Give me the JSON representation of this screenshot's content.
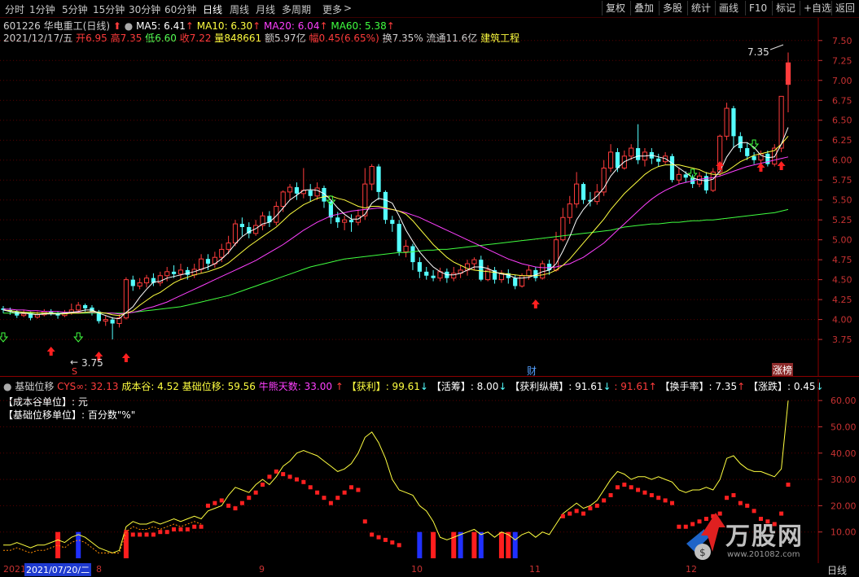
{
  "toolbar": {
    "tabs": [
      "分时",
      "1分钟",
      "5分钟",
      "15分钟",
      "30分钟",
      "60分钟",
      "日线",
      "周线",
      "月线",
      "多周期",
      "更多"
    ],
    "more_arrow": ">",
    "right_buttons": [
      "复权",
      "叠加",
      "多股",
      "统计",
      "画线",
      "F10",
      "标记",
      "+自选",
      "返回"
    ]
  },
  "header": {
    "code": "601226",
    "name": "华电重工",
    "period": "(日线)",
    "ma5": "MA5: 6.41",
    "ma10": "MA10: 6.30",
    "ma20": "MA20: 6.04",
    "ma60": "MA60: 5.38",
    "date": "2021/12/17/五",
    "open_label": "开",
    "open": "6.95",
    "high_label": "高",
    "high": "7.35",
    "low_label": "低",
    "low": "6.60",
    "close_label": "收",
    "close": "7.22",
    "vol_label": "量",
    "vol": "848661",
    "amt_label": "额",
    "amt": "5.97亿",
    "chg_label": "幅",
    "chg": "0.45(6.65%)",
    "turnover": "换7.35%",
    "float": "流通11.6亿",
    "sector": "建筑工程"
  },
  "colors": {
    "up": "#ff3c3c",
    "down": "#54ffff",
    "ma5": "#ffffff",
    "ma10": "#ffff40",
    "ma20": "#ff40ff",
    "ma60": "#40ff40",
    "axis": "#c83232",
    "grid": "#6a0000"
  },
  "price_axis": [
    "7.50",
    "7.25",
    "7.00",
    "6.75",
    "6.50",
    "6.25",
    "6.00",
    "5.75",
    "5.50",
    "5.25",
    "5.00",
    "4.75",
    "4.50",
    "4.25",
    "4.00",
    "3.75"
  ],
  "annotations": {
    "high_label": "7.35",
    "low_label": "3.75",
    "cai_label": "财",
    "zhangbang_label": "涨榜",
    "s_label": "S"
  },
  "indicator": {
    "title": "基础位移",
    "cys": "CYS∞: 32.13",
    "cost_valley": "成本谷: 4.52",
    "base_shift": "基础位移: 59.56",
    "bull_days": "牛熊天数: 33.00",
    "profit": "【获利】: 99.61",
    "active": "【活筹】: 8.00",
    "profit_long": "【获利纵横】: 91.61",
    "p2": ": 91.61",
    "turnover": "【换手率】: 7.35",
    "change": "【涨跌】: 0.45",
    "note1": "【成本谷单位】: 元",
    "note2": "【基础位移单位】: 百分数\"%\"",
    "axis": [
      "60.00",
      "50.00",
      "40.00",
      "30.00",
      "20.00",
      "10.00"
    ]
  },
  "date_axis": {
    "year": "2021",
    "cursor_date": "2021/07/20/二",
    "m8": "8",
    "m9": "9",
    "m10": "10",
    "m11": "11",
    "m12": "12",
    "period": "日线"
  },
  "watermark": {
    "title": "万股网",
    "url": "www.201082.com"
  },
  "chart_data": {
    "type": "candlestick",
    "ylim": [
      3.7,
      7.6
    ],
    "candles": [
      [
        4.14,
        4.12,
        4.17,
        4.08
      ],
      [
        4.12,
        4.1,
        4.15,
        4.06
      ],
      [
        4.1,
        4.05,
        4.12,
        4.02
      ],
      [
        4.05,
        4.07,
        4.12,
        4.03
      ],
      [
        4.08,
        4.02,
        4.1,
        3.99
      ],
      [
        4.03,
        4.06,
        4.1,
        4.01
      ],
      [
        4.06,
        4.1,
        4.13,
        4.04
      ],
      [
        4.1,
        4.08,
        4.13,
        4.05
      ],
      [
        4.08,
        4.05,
        4.1,
        4.01
      ],
      [
        4.05,
        4.08,
        4.12,
        4.03
      ],
      [
        4.08,
        4.12,
        4.2,
        4.06
      ],
      [
        4.12,
        4.18,
        4.22,
        4.08
      ],
      [
        4.18,
        4.14,
        4.2,
        4.1
      ],
      [
        4.15,
        4.1,
        4.18,
        4.05
      ],
      [
        4.1,
        3.98,
        4.12,
        3.95
      ],
      [
        3.98,
        4.0,
        4.05,
        3.92
      ],
      [
        4.0,
        3.95,
        4.03,
        3.75
      ],
      [
        3.95,
        4.02,
        4.06,
        3.9
      ],
      [
        4.02,
        4.5,
        4.53,
        4.0
      ],
      [
        4.5,
        4.42,
        4.55,
        4.36
      ],
      [
        4.42,
        4.46,
        4.52,
        4.38
      ],
      [
        4.46,
        4.52,
        4.56,
        4.4
      ],
      [
        4.52,
        4.46,
        4.58,
        4.42
      ],
      [
        4.46,
        4.55,
        4.6,
        4.42
      ],
      [
        4.55,
        4.6,
        4.66,
        4.48
      ],
      [
        4.6,
        4.57,
        4.68,
        4.52
      ],
      [
        4.57,
        4.62,
        4.7,
        4.5
      ],
      [
        4.62,
        4.56,
        4.66,
        4.5
      ],
      [
        4.56,
        4.63,
        4.7,
        4.52
      ],
      [
        4.63,
        4.76,
        4.82,
        4.58
      ],
      [
        4.76,
        4.7,
        4.82,
        4.62
      ],
      [
        4.7,
        4.78,
        4.85,
        4.65
      ],
      [
        4.78,
        4.88,
        4.95,
        4.72
      ],
      [
        4.88,
        4.96,
        5.05,
        4.82
      ],
      [
        4.96,
        5.2,
        5.25,
        4.92
      ],
      [
        5.2,
        5.16,
        5.28,
        5.05
      ],
      [
        5.16,
        5.08,
        5.22,
        5.02
      ],
      [
        5.08,
        5.18,
        5.25,
        5.05
      ],
      [
        5.18,
        5.3,
        5.35,
        5.12
      ],
      [
        5.3,
        5.22,
        5.36,
        5.16
      ],
      [
        5.22,
        5.42,
        5.48,
        5.18
      ],
      [
        5.42,
        5.6,
        5.62,
        5.35
      ],
      [
        5.6,
        5.66,
        5.7,
        5.5
      ],
      [
        5.66,
        5.58,
        5.72,
        5.5
      ],
      [
        5.58,
        5.62,
        5.9,
        5.52
      ],
      [
        5.62,
        5.55,
        5.7,
        5.48
      ],
      [
        5.55,
        5.65,
        5.72,
        5.5
      ],
      [
        5.65,
        5.48,
        5.68,
        5.4
      ],
      [
        5.48,
        5.28,
        5.5,
        5.2
      ],
      [
        5.28,
        5.22,
        5.35,
        5.15
      ],
      [
        5.22,
        5.25,
        5.3,
        5.12
      ],
      [
        5.25,
        5.22,
        5.32,
        5.1
      ],
      [
        5.22,
        5.3,
        5.38,
        5.18
      ],
      [
        5.3,
        5.7,
        5.9,
        5.25
      ],
      [
        5.7,
        5.92,
        5.95,
        5.62
      ],
      [
        5.92,
        5.6,
        5.95,
        5.5
      ],
      [
        5.6,
        5.25,
        5.62,
        5.2
      ],
      [
        5.25,
        5.2,
        5.3,
        5.1
      ],
      [
        5.2,
        4.85,
        5.25,
        4.8
      ],
      [
        4.85,
        4.92,
        5.0,
        4.78
      ],
      [
        4.92,
        4.72,
        4.95,
        4.62
      ],
      [
        4.72,
        4.6,
        4.78,
        4.52
      ],
      [
        4.6,
        4.55,
        4.66,
        4.5
      ],
      [
        4.55,
        4.52,
        4.62,
        4.48
      ],
      [
        4.52,
        4.6,
        4.65,
        4.48
      ],
      [
        4.6,
        4.52,
        4.64,
        4.46
      ],
      [
        4.52,
        4.58,
        4.66,
        4.48
      ],
      [
        4.58,
        4.62,
        4.68,
        4.52
      ],
      [
        4.62,
        4.7,
        4.75,
        4.55
      ],
      [
        4.7,
        4.75,
        4.78,
        4.62
      ],
      [
        4.75,
        4.5,
        4.8,
        4.48
      ],
      [
        4.5,
        4.62,
        4.68,
        4.48
      ],
      [
        4.62,
        4.5,
        4.66,
        4.45
      ],
      [
        4.5,
        4.58,
        4.62,
        4.46
      ],
      [
        4.58,
        4.52,
        4.63,
        4.45
      ],
      [
        4.52,
        4.42,
        4.56,
        4.38
      ],
      [
        4.42,
        4.55,
        4.58,
        4.4
      ],
      [
        4.55,
        4.62,
        4.68,
        4.5
      ],
      [
        4.62,
        4.52,
        4.66,
        4.48
      ],
      [
        4.52,
        4.7,
        4.74,
        4.5
      ],
      [
        4.7,
        4.62,
        4.75,
        4.56
      ],
      [
        4.62,
        5.0,
        5.1,
        4.6
      ],
      [
        5.0,
        5.28,
        5.4,
        4.98
      ],
      [
        5.28,
        5.45,
        5.55,
        5.2
      ],
      [
        5.45,
        5.7,
        5.85,
        5.4
      ],
      [
        5.7,
        5.5,
        5.72,
        5.45
      ],
      [
        5.5,
        5.48,
        5.6,
        5.42
      ],
      [
        5.48,
        5.6,
        5.7,
        5.44
      ],
      [
        5.6,
        5.9,
        6.0,
        5.55
      ],
      [
        5.9,
        6.1,
        6.2,
        5.85
      ],
      [
        6.1,
        5.9,
        6.15,
        5.85
      ],
      [
        5.9,
        6.05,
        6.12,
        5.88
      ],
      [
        6.05,
        6.15,
        6.2,
        6.0
      ],
      [
        6.15,
        6.0,
        6.45,
        5.95
      ],
      [
        6.0,
        6.1,
        6.15,
        5.92
      ],
      [
        6.1,
        6.02,
        6.15,
        5.95
      ],
      [
        6.02,
        5.98,
        6.08,
        5.92
      ],
      [
        5.98,
        6.05,
        6.1,
        5.95
      ],
      [
        6.05,
        5.75,
        6.08,
        5.72
      ],
      [
        5.75,
        5.82,
        5.9,
        5.7
      ],
      [
        5.82,
        5.78,
        5.86,
        5.72
      ],
      [
        5.78,
        5.7,
        5.82,
        5.65
      ],
      [
        5.7,
        5.8,
        5.85,
        5.66
      ],
      [
        5.8,
        5.62,
        5.85,
        5.58
      ],
      [
        5.62,
        5.85,
        5.9,
        5.6
      ],
      [
        5.85,
        6.3,
        6.32,
        5.8
      ],
      [
        6.3,
        6.65,
        6.72,
        6.25
      ],
      [
        6.65,
        6.3,
        6.68,
        6.15
      ],
      [
        6.3,
        6.15,
        6.35,
        6.1
      ],
      [
        6.15,
        6.05,
        6.22,
        6.0
      ],
      [
        6.05,
        6.0,
        6.1,
        5.95
      ],
      [
        6.0,
        6.08,
        6.12,
        5.95
      ],
      [
        6.08,
        5.95,
        6.12,
        5.92
      ],
      [
        5.95,
        6.15,
        6.2,
        5.92
      ],
      [
        6.15,
        6.8,
        6.8,
        6.1
      ],
      [
        6.95,
        7.22,
        7.35,
        6.6
      ]
    ],
    "ma5": [
      4.12,
      4.1,
      4.08,
      4.08,
      4.07,
      4.06,
      4.07,
      4.07,
      4.07,
      4.08,
      4.09,
      4.1,
      4.12,
      4.12,
      4.08,
      4.05,
      4.02,
      4.01,
      4.09,
      4.16,
      4.28,
      4.38,
      4.47,
      4.48,
      4.52,
      4.54,
      4.56,
      4.58,
      4.6,
      4.63,
      4.66,
      4.7,
      4.76,
      4.84,
      4.95,
      5.04,
      5.1,
      5.14,
      5.2,
      5.22,
      5.3,
      5.4,
      5.5,
      5.56,
      5.62,
      5.63,
      5.62,
      5.58,
      5.5,
      5.4,
      5.32,
      5.26,
      5.26,
      5.32,
      5.46,
      5.52,
      5.5,
      5.46,
      5.3,
      5.12,
      4.98,
      4.85,
      4.75,
      4.66,
      4.6,
      4.56,
      4.56,
      4.58,
      4.62,
      4.66,
      4.66,
      4.64,
      4.6,
      4.57,
      4.56,
      4.52,
      4.52,
      4.53,
      4.56,
      4.6,
      4.62,
      4.7,
      4.86,
      5.04,
      5.25,
      5.38,
      5.48,
      5.55,
      5.65,
      5.8,
      5.9,
      5.98,
      6.02,
      6.05,
      6.05,
      6.06,
      6.04,
      6.02,
      5.96,
      5.9,
      5.84,
      5.78,
      5.75,
      5.74,
      5.76,
      5.86,
      6.04,
      6.16,
      6.22,
      6.22,
      6.16,
      6.06,
      6.03,
      6.04,
      6.2,
      6.41
    ],
    "ma10": [
      4.12,
      4.11,
      4.1,
      4.09,
      4.09,
      4.08,
      4.08,
      4.08,
      4.07,
      4.07,
      4.08,
      4.08,
      4.09,
      4.1,
      4.09,
      4.08,
      4.06,
      4.05,
      4.08,
      4.11,
      4.18,
      4.24,
      4.3,
      4.34,
      4.4,
      4.46,
      4.5,
      4.53,
      4.56,
      4.58,
      4.6,
      4.63,
      4.66,
      4.71,
      4.78,
      4.85,
      4.92,
      4.98,
      5.04,
      5.1,
      5.16,
      5.24,
      5.32,
      5.38,
      5.44,
      5.48,
      5.52,
      5.54,
      5.55,
      5.52,
      5.5,
      5.46,
      5.42,
      5.4,
      5.42,
      5.42,
      5.4,
      5.38,
      5.36,
      5.32,
      5.24,
      5.14,
      5.04,
      4.94,
      4.86,
      4.78,
      4.72,
      4.68,
      4.64,
      4.62,
      4.61,
      4.6,
      4.59,
      4.58,
      4.57,
      4.56,
      4.55,
      4.55,
      4.55,
      4.56,
      4.58,
      4.62,
      4.68,
      4.76,
      4.86,
      4.96,
      5.06,
      5.16,
      5.26,
      5.38,
      5.48,
      5.58,
      5.66,
      5.74,
      5.82,
      5.88,
      5.92,
      5.94,
      5.94,
      5.94,
      5.92,
      5.9,
      5.88,
      5.84,
      5.82,
      5.82,
      5.86,
      5.92,
      5.98,
      6.02,
      6.06,
      6.08,
      6.1,
      6.12,
      6.2,
      6.3
    ],
    "ma20": [
      4.13,
      4.13,
      4.12,
      4.12,
      4.11,
      4.11,
      4.1,
      4.1,
      4.1,
      4.09,
      4.09,
      4.09,
      4.09,
      4.09,
      4.09,
      4.08,
      4.08,
      4.07,
      4.08,
      4.09,
      4.11,
      4.14,
      4.16,
      4.19,
      4.22,
      4.26,
      4.3,
      4.34,
      4.38,
      4.42,
      4.46,
      4.5,
      4.54,
      4.58,
      4.62,
      4.66,
      4.7,
      4.74,
      4.79,
      4.84,
      4.89,
      4.94,
      5.0,
      5.06,
      5.12,
      5.17,
      5.22,
      5.26,
      5.3,
      5.32,
      5.34,
      5.36,
      5.37,
      5.38,
      5.39,
      5.4,
      5.39,
      5.38,
      5.36,
      5.34,
      5.31,
      5.28,
      5.24,
      5.2,
      5.16,
      5.12,
      5.08,
      5.04,
      5.0,
      4.96,
      4.92,
      4.88,
      4.84,
      4.8,
      4.76,
      4.73,
      4.7,
      4.68,
      4.66,
      4.65,
      4.65,
      4.66,
      4.68,
      4.7,
      4.74,
      4.78,
      4.84,
      4.9,
      4.96,
      5.04,
      5.12,
      5.2,
      5.28,
      5.36,
      5.44,
      5.51,
      5.57,
      5.62,
      5.66,
      5.7,
      5.72,
      5.74,
      5.76,
      5.77,
      5.78,
      5.8,
      5.83,
      5.86,
      5.89,
      5.92,
      5.94,
      5.96,
      5.98,
      6.0,
      6.02,
      6.04
    ],
    "ma60": [
      4.08,
      4.08,
      4.08,
      4.08,
      4.08,
      4.08,
      4.08,
      4.08,
      4.08,
      4.08,
      4.08,
      4.08,
      4.08,
      4.08,
      4.08,
      4.08,
      4.08,
      4.08,
      4.08,
      4.09,
      4.1,
      4.11,
      4.12,
      4.13,
      4.14,
      4.15,
      4.16,
      4.18,
      4.2,
      4.22,
      4.24,
      4.26,
      4.28,
      4.3,
      4.33,
      4.36,
      4.39,
      4.42,
      4.45,
      4.48,
      4.51,
      4.54,
      4.57,
      4.6,
      4.63,
      4.66,
      4.68,
      4.7,
      4.72,
      4.74,
      4.76,
      4.77,
      4.78,
      4.79,
      4.8,
      4.81,
      4.82,
      4.83,
      4.84,
      4.84,
      4.85,
      4.86,
      4.87,
      4.87,
      4.88,
      4.88,
      4.89,
      4.9,
      4.91,
      4.92,
      4.93,
      4.94,
      4.95,
      4.96,
      4.97,
      4.98,
      4.99,
      5.0,
      5.01,
      5.02,
      5.03,
      5.04,
      5.05,
      5.06,
      5.07,
      5.08,
      5.09,
      5.1,
      5.11,
      5.12,
      5.14,
      5.16,
      5.17,
      5.18,
      5.19,
      5.2,
      5.2,
      5.21,
      5.22,
      5.22,
      5.23,
      5.24,
      5.24,
      5.25,
      5.25,
      5.26,
      5.27,
      5.28,
      5.29,
      5.3,
      5.31,
      5.32,
      5.33,
      5.34,
      5.36,
      5.38
    ],
    "indicator_yellow": [
      5,
      5,
      6,
      5,
      4,
      5,
      5,
      6,
      7,
      6,
      8,
      9,
      8,
      6,
      4,
      3,
      2,
      3,
      12,
      14,
      13,
      13,
      14,
      13,
      14,
      15,
      14,
      15,
      16,
      15,
      18,
      19,
      20,
      24,
      27,
      26,
      25,
      28,
      30,
      28,
      31,
      35,
      37,
      40,
      41,
      40,
      39,
      37,
      35,
      33,
      34,
      36,
      40,
      46,
      48,
      44,
      38,
      30,
      26,
      25,
      24,
      20,
      18,
      14,
      8,
      7,
      8,
      9,
      10,
      11,
      9,
      10,
      8,
      10,
      9,
      7,
      9,
      10,
      8,
      10,
      9,
      13,
      17,
      19,
      21,
      19,
      20,
      22,
      26,
      30,
      33,
      32,
      30,
      31,
      31,
      30,
      31,
      30,
      29,
      26,
      25,
      26,
      26,
      27,
      26,
      30,
      38,
      39,
      36,
      34,
      33,
      33,
      32,
      31,
      34,
      60
    ],
    "indicator_red_dots": [
      null,
      null,
      null,
      null,
      null,
      null,
      null,
      null,
      null,
      null,
      null,
      null,
      null,
      null,
      null,
      null,
      null,
      null,
      10,
      9,
      9,
      9,
      9,
      10,
      10,
      11,
      11,
      11,
      12,
      12,
      20,
      21,
      22,
      20,
      19,
      21,
      23,
      25,
      28,
      31,
      33,
      32,
      31,
      30,
      29,
      27,
      25,
      23,
      21,
      23,
      25,
      27,
      26,
      14,
      9,
      8,
      7,
      6,
      5,
      null,
      null,
      null,
      null,
      null,
      null,
      null,
      null,
      null,
      null,
      null,
      null,
      null,
      null,
      null,
      null,
      null,
      null,
      null,
      null,
      null,
      null,
      null,
      16,
      17,
      18,
      17,
      19,
      20,
      22,
      24,
      27,
      28,
      27,
      26,
      25,
      24,
      23,
      22,
      21,
      12,
      12,
      13,
      14,
      15,
      16,
      17,
      23,
      24,
      21,
      20,
      18,
      15,
      14,
      13,
      17,
      28
    ],
    "indicator_ylim": [
      0,
      65
    ],
    "signal_bars": [
      [
        8,
        "red"
      ],
      [
        11,
        "blue"
      ],
      [
        18,
        "red"
      ],
      [
        61,
        "blue"
      ],
      [
        63,
        "red"
      ],
      [
        66,
        "red"
      ],
      [
        67,
        "blue"
      ],
      [
        69,
        "red"
      ],
      [
        70,
        "blue"
      ],
      [
        73,
        "red"
      ],
      [
        74,
        "red"
      ],
      [
        75,
        "blue"
      ]
    ]
  }
}
